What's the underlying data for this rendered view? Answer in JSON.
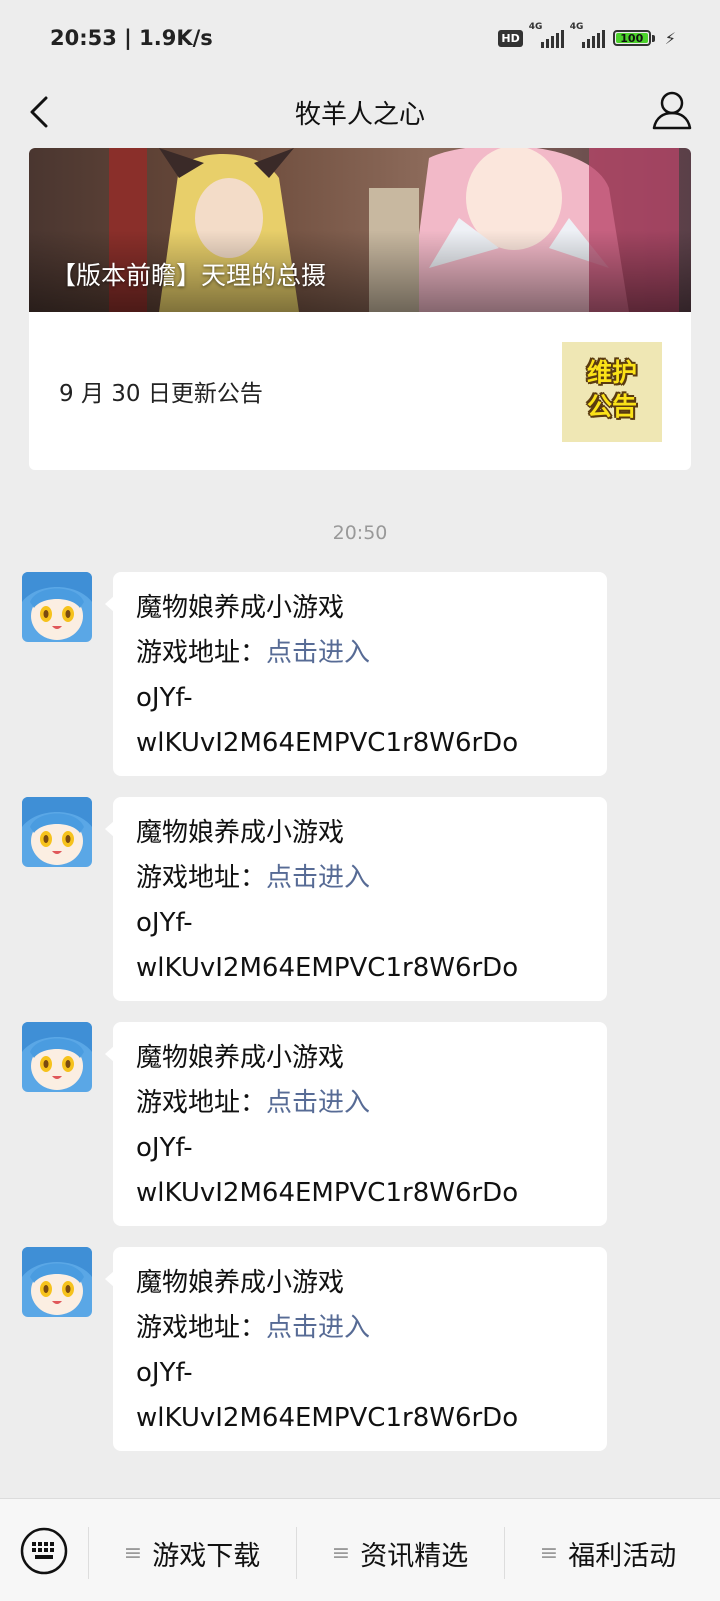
{
  "status_bar": {
    "time_speed": "20:53 | 1.9K/s",
    "hd": "HD",
    "net1": "4G",
    "net2": "4G",
    "battery": "100"
  },
  "header": {
    "title": "牧羊人之心"
  },
  "article_card": {
    "cover_title": "【版本前瞻】天理的总摄",
    "sub_article_title": "9 月 30 日更新公告",
    "sub_thumb_text_1": "维护",
    "sub_thumb_text_2": "公告"
  },
  "timestamp": "20:50",
  "messages": [
    {
      "title": "魔物娘养成小游戏",
      "address_label": "游戏地址：",
      "link": "点击进入",
      "code_1": "oJYf-",
      "code_2": "wlKUvI2M64EMPVC1r8W6rDo"
    },
    {
      "title": "魔物娘养成小游戏",
      "address_label": "游戏地址：",
      "link": "点击进入",
      "code_1": "oJYf-",
      "code_2": "wlKUvI2M64EMPVC1r8W6rDo"
    },
    {
      "title": "魔物娘养成小游戏",
      "address_label": "游戏地址：",
      "link": "点击进入",
      "code_1": "oJYf-",
      "code_2": "wlKUvI2M64EMPVC1r8W6rDo"
    },
    {
      "title": "魔物娘养成小游戏",
      "address_label": "游戏地址：",
      "link": "点击进入",
      "code_1": "oJYf-",
      "code_2": "wlKUvI2M64EMPVC1r8W6rDo"
    }
  ],
  "bottom_menu": {
    "items": [
      "游戏下载",
      "资讯精选",
      "福利活动"
    ]
  },
  "colors": {
    "background": "#ededed",
    "link": "#576b95",
    "battery_fill": "#4cd22c"
  }
}
